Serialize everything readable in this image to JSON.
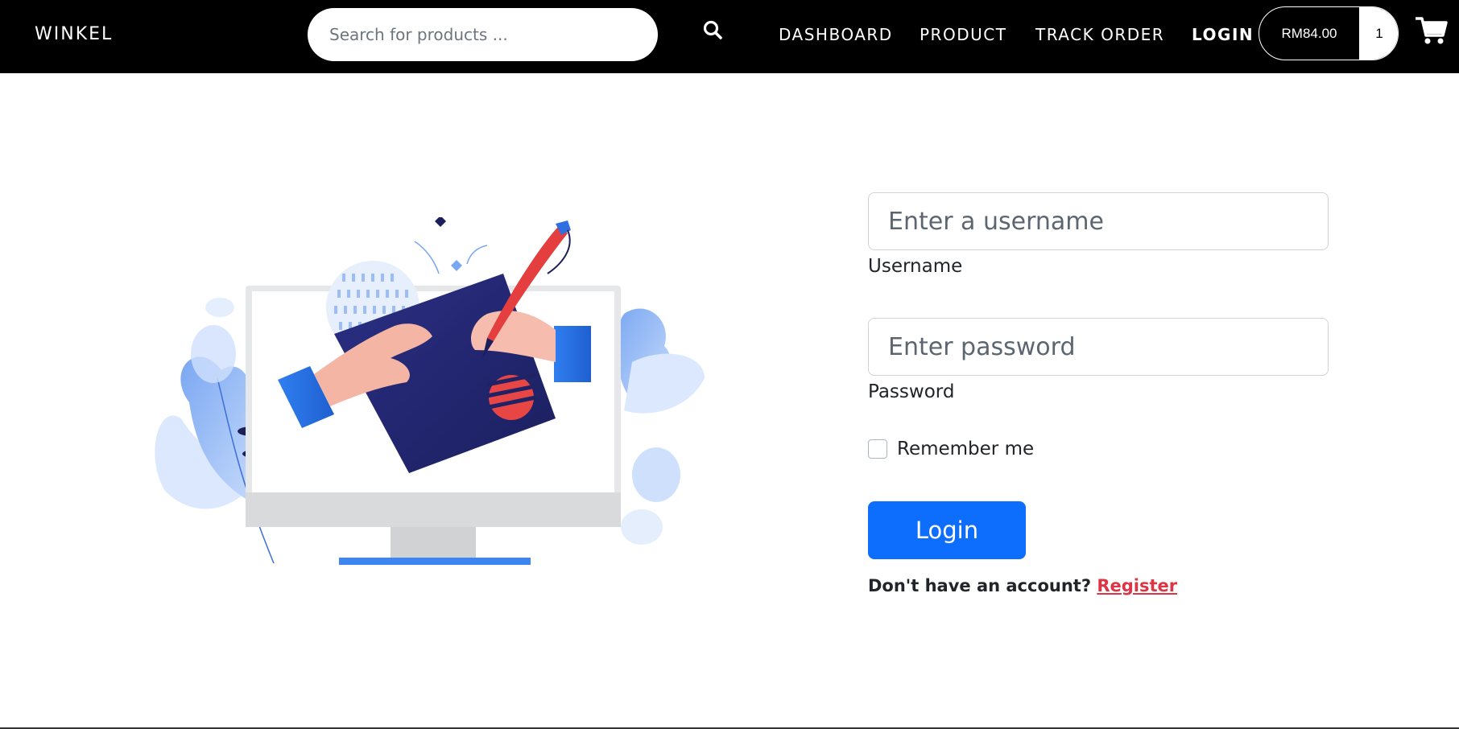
{
  "nav": {
    "brand": "WINKEL",
    "search_placeholder": "Search for products ...",
    "links": [
      "DASHBOARD",
      "PRODUCT",
      "TRACK ORDER",
      "LOGIN"
    ],
    "cart_amount": "RM84.00",
    "cart_count": "1"
  },
  "form": {
    "username_placeholder": "Enter a username",
    "username_label": "Username",
    "password_placeholder": "Enter password",
    "password_label": "Password",
    "remember_label": "Remember me",
    "login_label": "Login",
    "register_prompt": "Don't have an account?",
    "register_link": "Register"
  },
  "colors": {
    "navbar": "#000000",
    "primary": "#0d6efd",
    "link_red": "#dc3545"
  }
}
